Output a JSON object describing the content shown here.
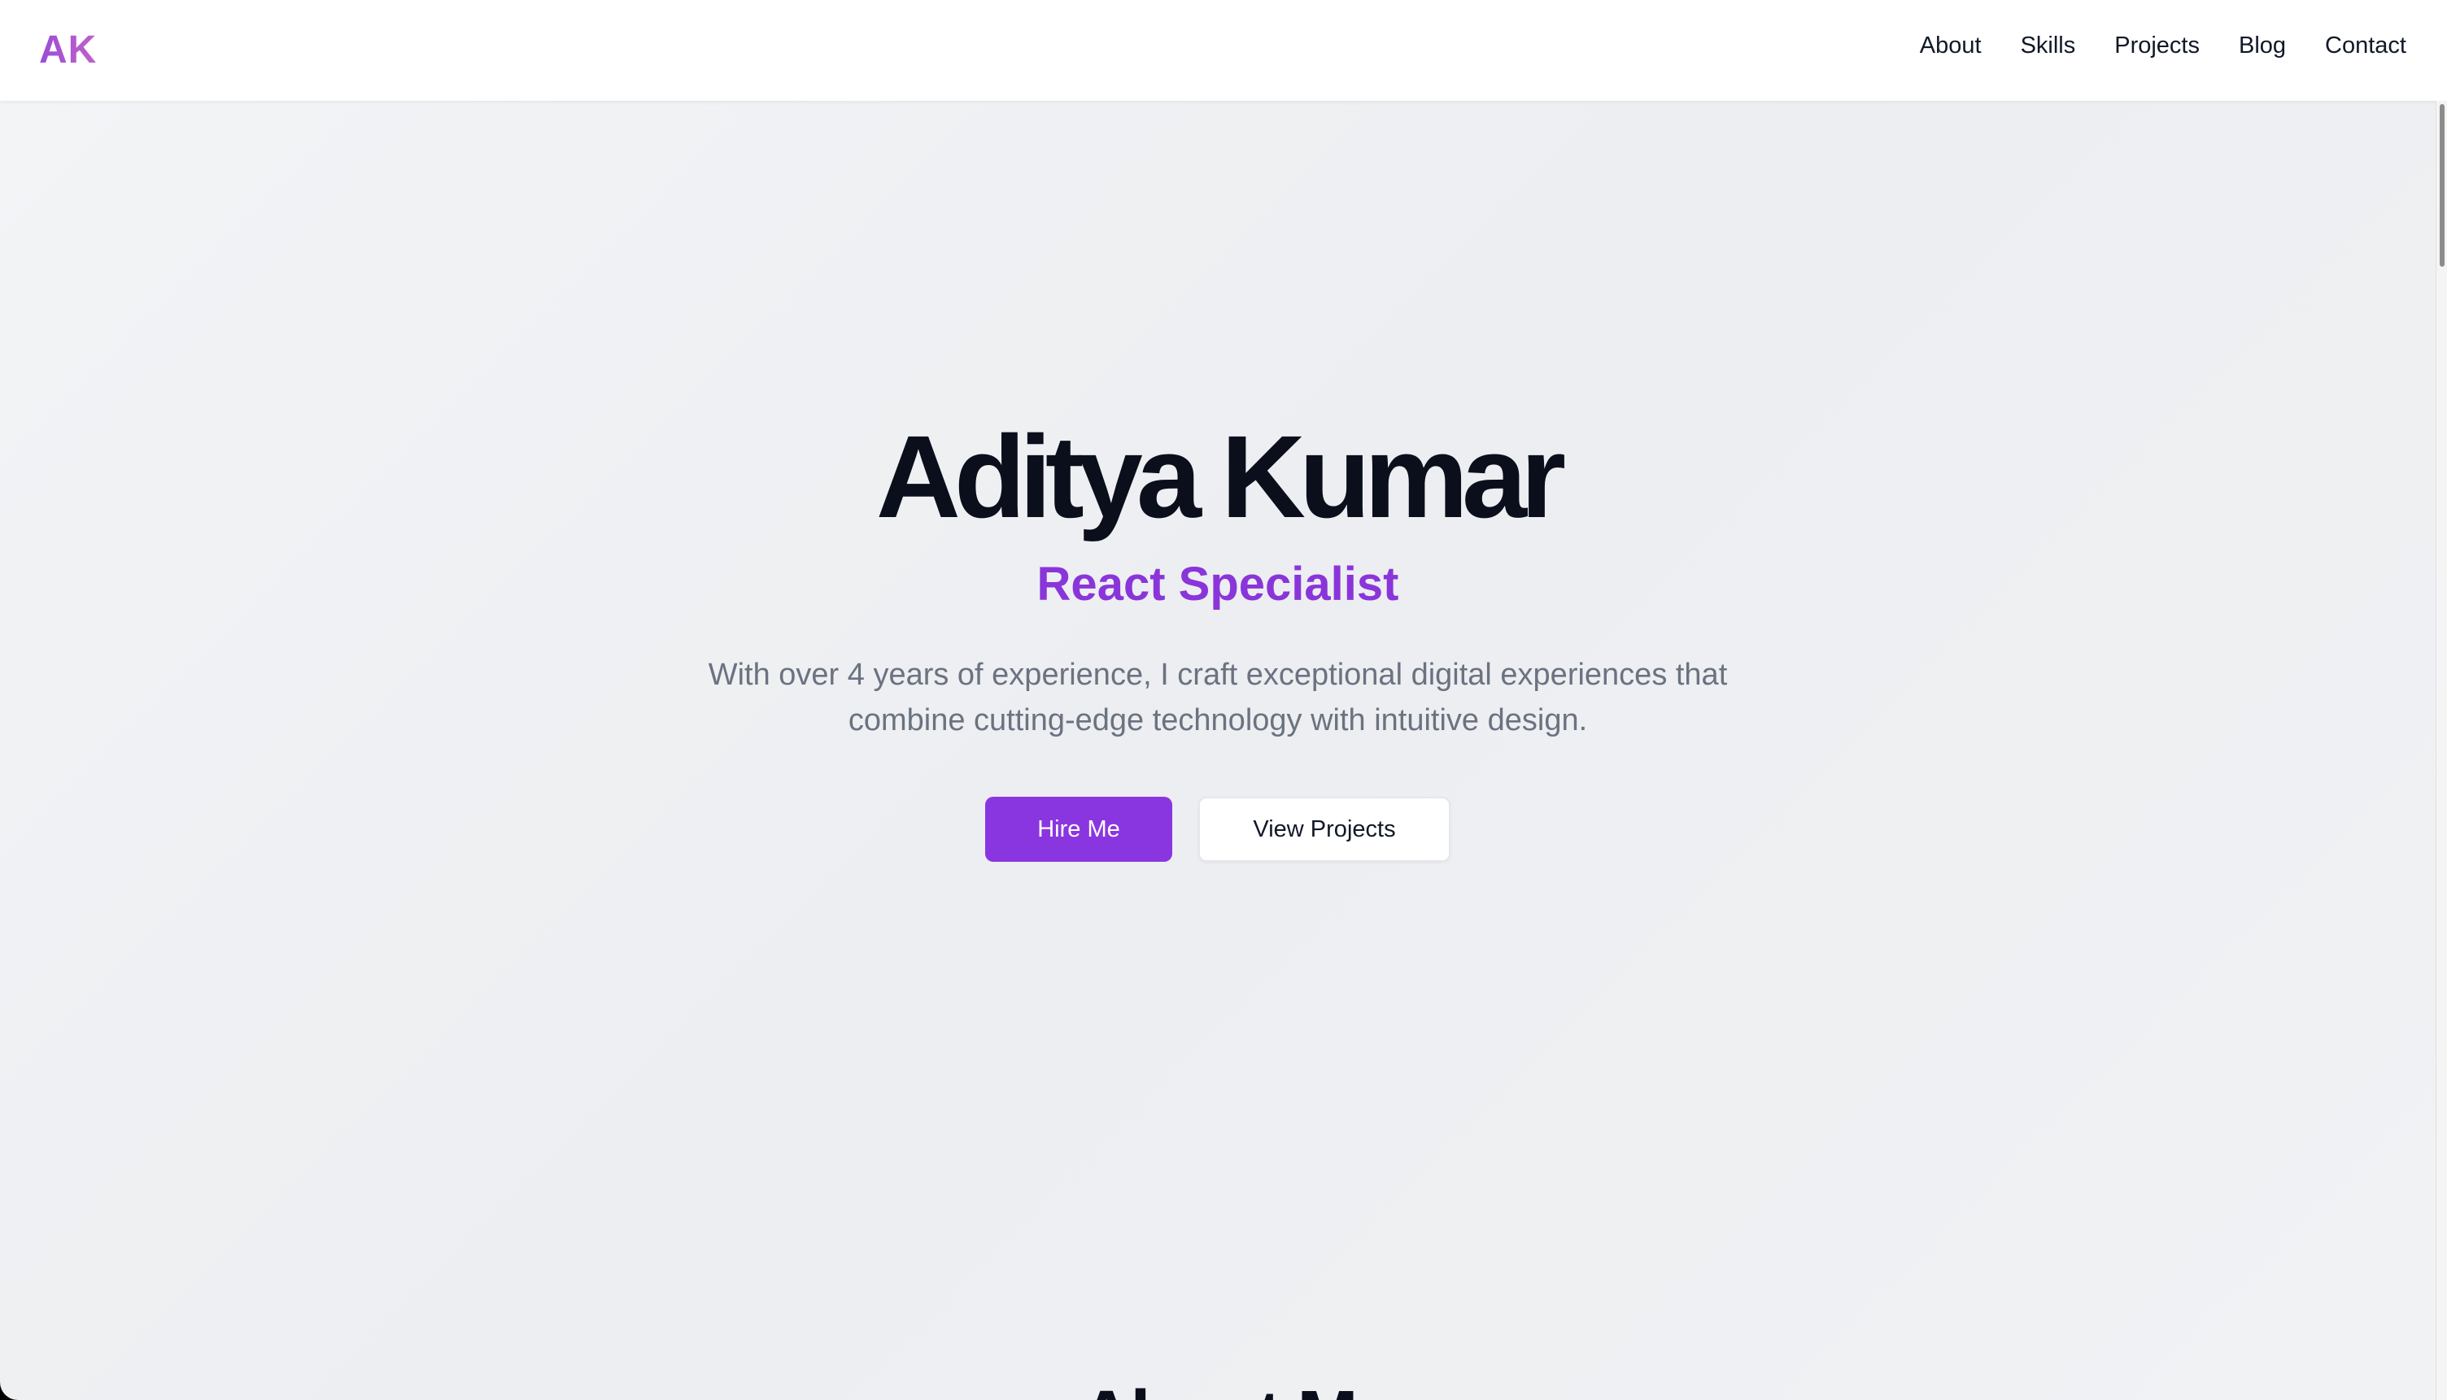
{
  "brand": {
    "logo": "AK",
    "accent": "#8a36e0"
  },
  "nav": {
    "links": [
      {
        "label": "About"
      },
      {
        "label": "Skills"
      },
      {
        "label": "Projects"
      },
      {
        "label": "Blog"
      },
      {
        "label": "Contact"
      }
    ]
  },
  "hero": {
    "name": "Aditya Kumar",
    "role": "React Specialist",
    "description_lines": [
      "With over 4 years of experience, I craft exceptional digital experiences that",
      "combine cutting-edge technology with intuitive design."
    ],
    "primary_button": "Hire Me",
    "secondary_button": "View Projects"
  },
  "next_section": {
    "heading_partial": "About M"
  }
}
